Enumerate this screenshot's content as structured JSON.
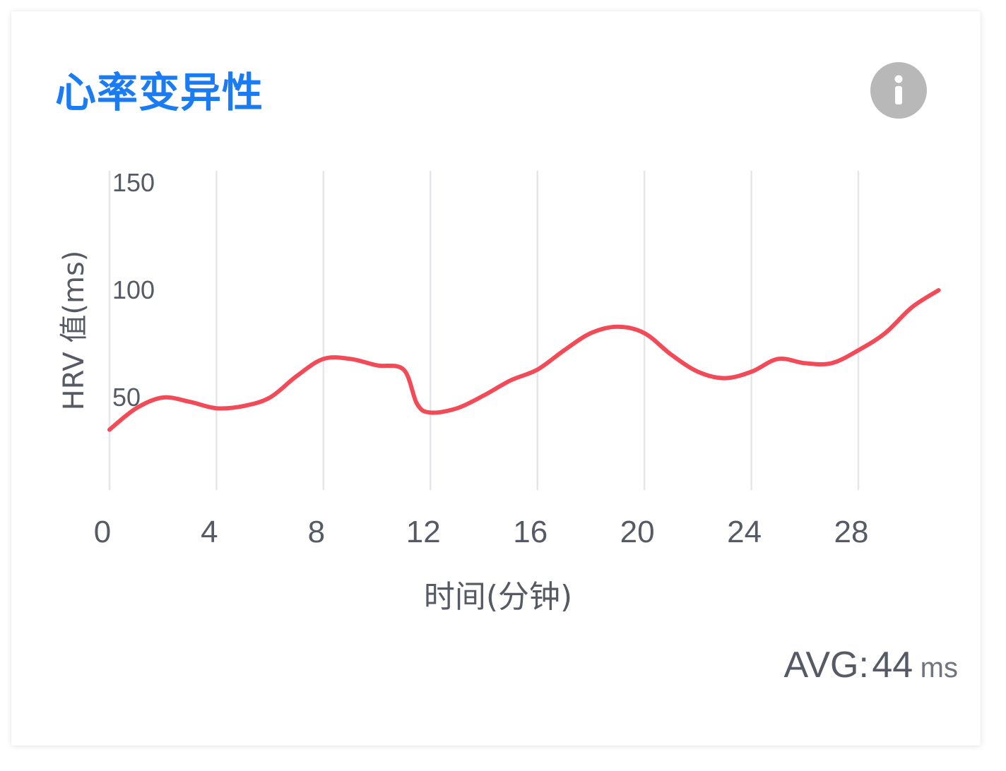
{
  "card": {
    "title": "心率变异性",
    "info_icon": "info-icon"
  },
  "summary": {
    "avg_label": "AVG:",
    "avg_value": "44",
    "avg_unit": "ms"
  },
  "colors": {
    "title": "#1a7cf5",
    "line": "#f34a58",
    "grid": "#e6e6ea",
    "axis_text": "#555a64",
    "info_bg": "#b8b8b8"
  },
  "chart_data": {
    "type": "line",
    "ylabel": "HRV 值(ms)",
    "xlabel": "时间(分钟)",
    "xlim": [
      0,
      31
    ],
    "ylim": [
      0,
      150
    ],
    "xticks": [
      "0",
      "4",
      "8",
      "12",
      "16",
      "20",
      "24",
      "28"
    ],
    "yticks": [
      "50",
      "100",
      "150"
    ],
    "grid": true,
    "series": [
      {
        "x": [
          0,
          1,
          2,
          3,
          4,
          5,
          6,
          7,
          8,
          9,
          10,
          11,
          11.5,
          12,
          13,
          14,
          15,
          16,
          17,
          18,
          19,
          20,
          21,
          22,
          23,
          24,
          25,
          26,
          27,
          28,
          29,
          30,
          31
        ],
        "y": [
          35,
          45,
          50,
          48,
          45,
          46,
          50,
          60,
          68,
          68,
          65,
          63,
          47,
          43,
          45,
          51,
          58,
          63,
          72,
          80,
          83,
          80,
          70,
          62,
          59,
          62,
          68,
          66,
          66,
          72,
          80,
          92,
          100
        ]
      }
    ]
  }
}
